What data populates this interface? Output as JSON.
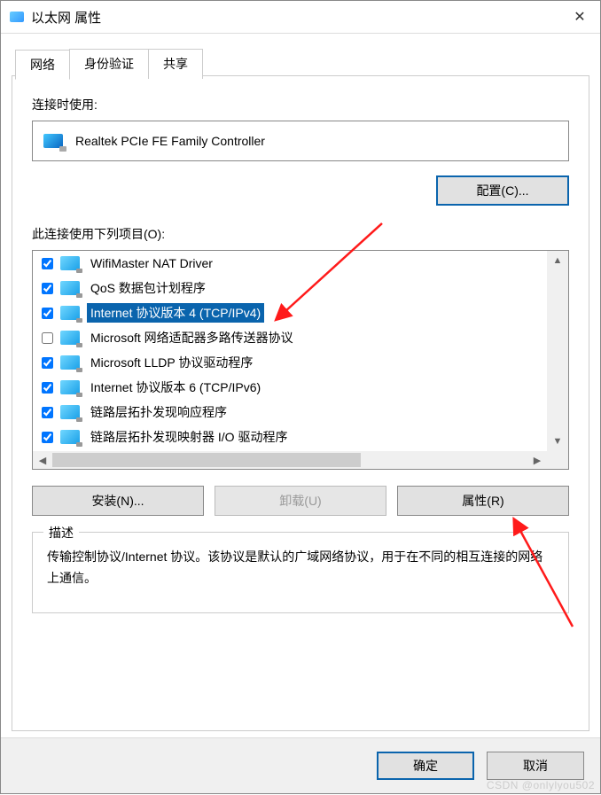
{
  "title": "以太网 属性",
  "tabs": [
    "网络",
    "身份验证",
    "共享"
  ],
  "active_tab": 0,
  "connect_using_label": "连接时使用:",
  "adapter_name": "Realtek PCIe FE Family Controller",
  "configure_btn": "配置(C)...",
  "items_label": "此连接使用下列项目(O):",
  "items": [
    {
      "checked": true,
      "label": "WifiMaster NAT Driver",
      "selected": false
    },
    {
      "checked": true,
      "label": "QoS 数据包计划程序",
      "selected": false
    },
    {
      "checked": true,
      "label": "Internet 协议版本 4 (TCP/IPv4)",
      "selected": true
    },
    {
      "checked": false,
      "label": "Microsoft 网络适配器多路传送器协议",
      "selected": false
    },
    {
      "checked": true,
      "label": "Microsoft LLDP 协议驱动程序",
      "selected": false
    },
    {
      "checked": true,
      "label": "Internet 协议版本 6 (TCP/IPv6)",
      "selected": false
    },
    {
      "checked": true,
      "label": "链路层拓扑发现响应程序",
      "selected": false
    },
    {
      "checked": true,
      "label": "链路层拓扑发现映射器 I/O 驱动程序",
      "selected": false
    }
  ],
  "install_btn": "安装(N)...",
  "uninstall_btn": "卸载(U)",
  "properties_btn": "属性(R)",
  "desc_legend": "描述",
  "desc_text": "传输控制协议/Internet 协议。该协议是默认的广域网络协议，用于在不同的相互连接的网络上通信。",
  "ok_btn": "确定",
  "cancel_btn": "取消",
  "watermark": "CSDN @onlylyou502"
}
